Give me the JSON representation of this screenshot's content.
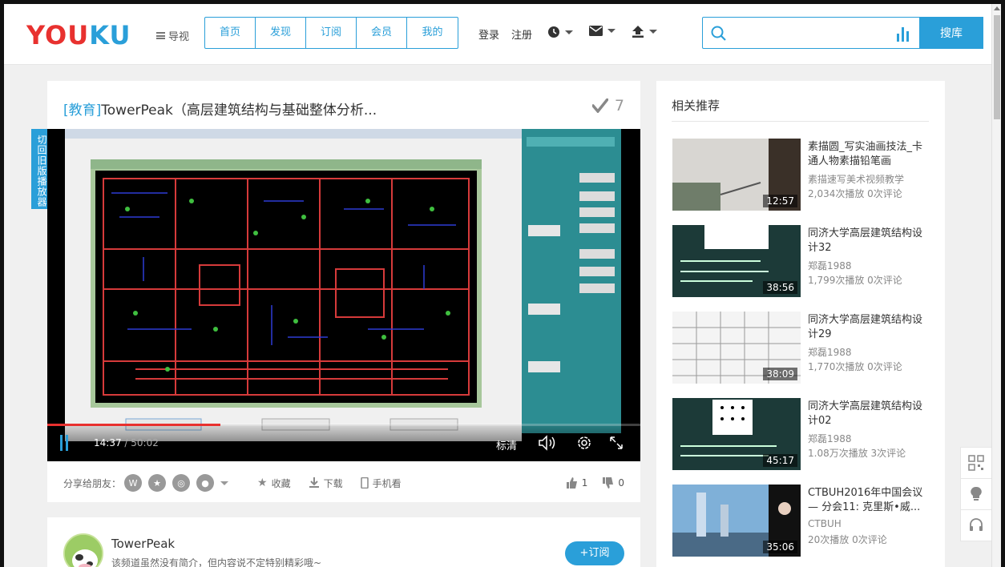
{
  "header": {
    "logo_left": "YOU",
    "logo_right": "KU",
    "nav_label": "导视",
    "tabs": [
      "首页",
      "发现",
      "订阅",
      "会员",
      "我的"
    ],
    "login": "登录",
    "register": "注册",
    "search_placeholder": "",
    "search_button": "搜库"
  },
  "video": {
    "tag": "[教育]",
    "title": "TowerPeak（高层建筑结构与基础整体分析...",
    "score": "7",
    "side_tab": "切回旧版播放器",
    "current_time": "14:37",
    "duration": "/ 50:02",
    "quality": "标清",
    "progress_fraction": 0.292
  },
  "actions": {
    "share_label": "分享给朋友：",
    "favorite": "收藏",
    "download": "下载",
    "mobile": "手机看",
    "likes": "1",
    "dislikes": "0"
  },
  "uploader": {
    "name": "TowerPeak",
    "description": "该频道虽然没有简介，但内容说不定特别精彩哦~",
    "subscribe": "+订阅"
  },
  "related": {
    "title": "相关推荐",
    "items": [
      {
        "name": "素描圆_写实油画技法_卡通人物素描铅笔画",
        "author": "素描速写美术视频教学",
        "stats": "2,034次播放 0次评论",
        "duration": "12:57"
      },
      {
        "name": "同济大学高层建筑结构设计32",
        "author": "郑磊1988",
        "stats": "1,799次播放 0次评论",
        "duration": "38:56"
      },
      {
        "name": "同济大学高层建筑结构设计29",
        "author": "郑磊1988",
        "stats": "1,770次播放 0次评论",
        "duration": "38:09"
      },
      {
        "name": "同济大学高层建筑结构设计02",
        "author": "郑磊1988",
        "stats": "1.08万次播放 3次评论",
        "duration": "45:17"
      },
      {
        "name": "CTBUH2016年中国会议 — 分会11: 克里斯•威...",
        "author": "CTBUH",
        "stats": "20次播放 0次评论",
        "duration": "35:06"
      }
    ]
  },
  "colors": {
    "accent": "#2a9fd9",
    "brand_red": "#e8312f"
  }
}
